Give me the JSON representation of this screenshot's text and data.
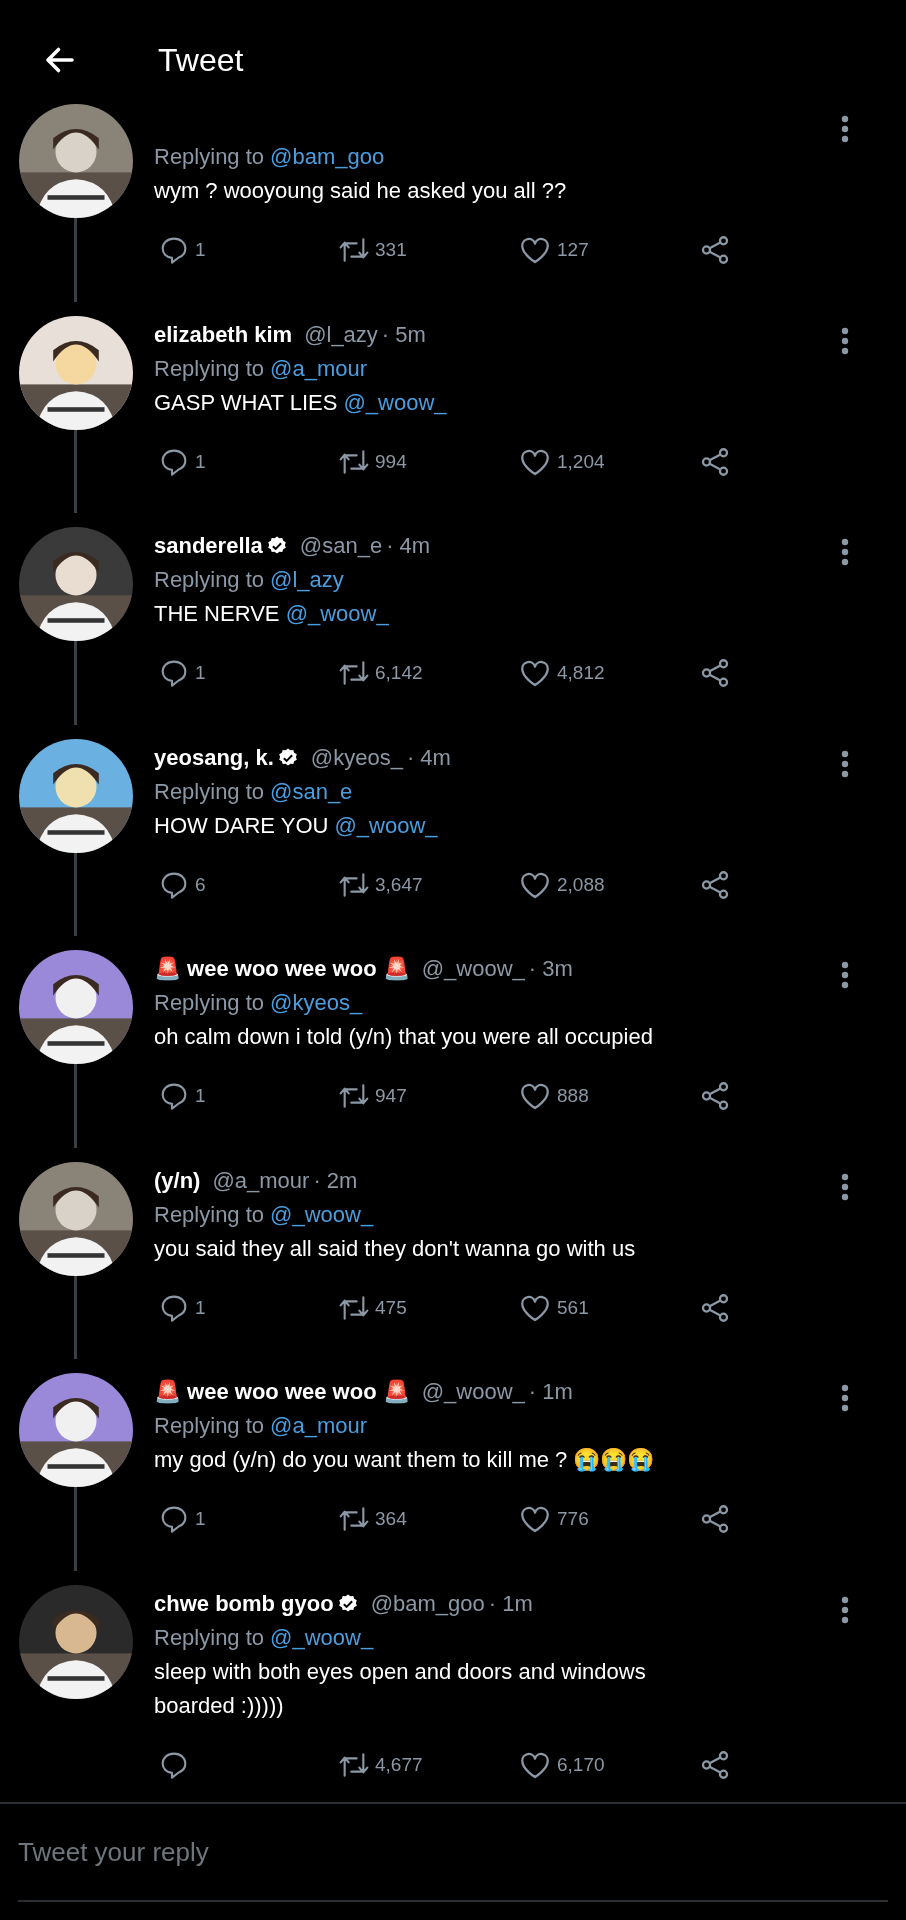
{
  "header": {
    "title": "Tweet"
  },
  "tweets": [
    {
      "reply_label": "Replying to",
      "replying_to": "@bam_goo",
      "text": "wym ? wooyoung said he asked you all ??",
      "replies": "1",
      "retweets": "331",
      "likes": "127"
    },
    {
      "name": "elizabeth kim",
      "verified": false,
      "handle": "@l_azy",
      "time": "· 5m",
      "reply_label": "Replying to",
      "replying_to": "@a_mour",
      "text": "GASP WHAT LIES",
      "mention": "@_woow_",
      "replies": "1",
      "retweets": "994",
      "likes": "1,204"
    },
    {
      "name": "sanderella",
      "verified": true,
      "handle": "@san_e",
      "time": "· 4m",
      "reply_label": "Replying to",
      "replying_to": "@l_azy",
      "text": "THE NERVE",
      "mention": "@_woow_",
      "replies": "1",
      "retweets": "6,142",
      "likes": "4,812"
    },
    {
      "name": "yeosang, k.",
      "verified": true,
      "handle": "@kyeos_",
      "time": "· 4m",
      "reply_label": "Replying to",
      "replying_to": "@san_e",
      "text": "HOW DARE YOU",
      "mention": "@_woow_",
      "replies": "6",
      "retweets": "3,647",
      "likes": "2,088"
    },
    {
      "name": "🚨 wee woo wee woo 🚨",
      "verified": false,
      "handle": "@_woow_",
      "time": "· 3m",
      "reply_label": "Replying to",
      "replying_to": "@kyeos_",
      "text": "oh calm down i told (y/n) that you were all occupied",
      "replies": "1",
      "retweets": "947",
      "likes": "888"
    },
    {
      "name": "(y/n)",
      "verified": false,
      "handle": "@a_mour",
      "time": "· 2m",
      "reply_label": "Replying to",
      "replying_to": "@_woow_",
      "text": "you said they all said they don't wanna go with us",
      "replies": "1",
      "retweets": "475",
      "likes": "561"
    },
    {
      "name": "🚨 wee woo wee woo 🚨",
      "verified": false,
      "handle": "@_woow_",
      "time": "· 1m",
      "reply_label": "Replying to",
      "replying_to": "@a_mour",
      "text": "my god (y/n) do you want them to kill me ? 😭😭😭",
      "replies": "1",
      "retweets": "364",
      "likes": "776"
    },
    {
      "name": "chwe bomb gyoo",
      "verified": true,
      "handle": "@bam_goo",
      "time": "· 1m",
      "reply_label": "Replying to",
      "replying_to": "@_woow_",
      "text": "sleep with both eyes open and doors and windows boarded :)))))",
      "retweets": "4,677",
      "likes": "6,170"
    }
  ],
  "reply_box": {
    "placeholder": "Tweet your reply"
  }
}
